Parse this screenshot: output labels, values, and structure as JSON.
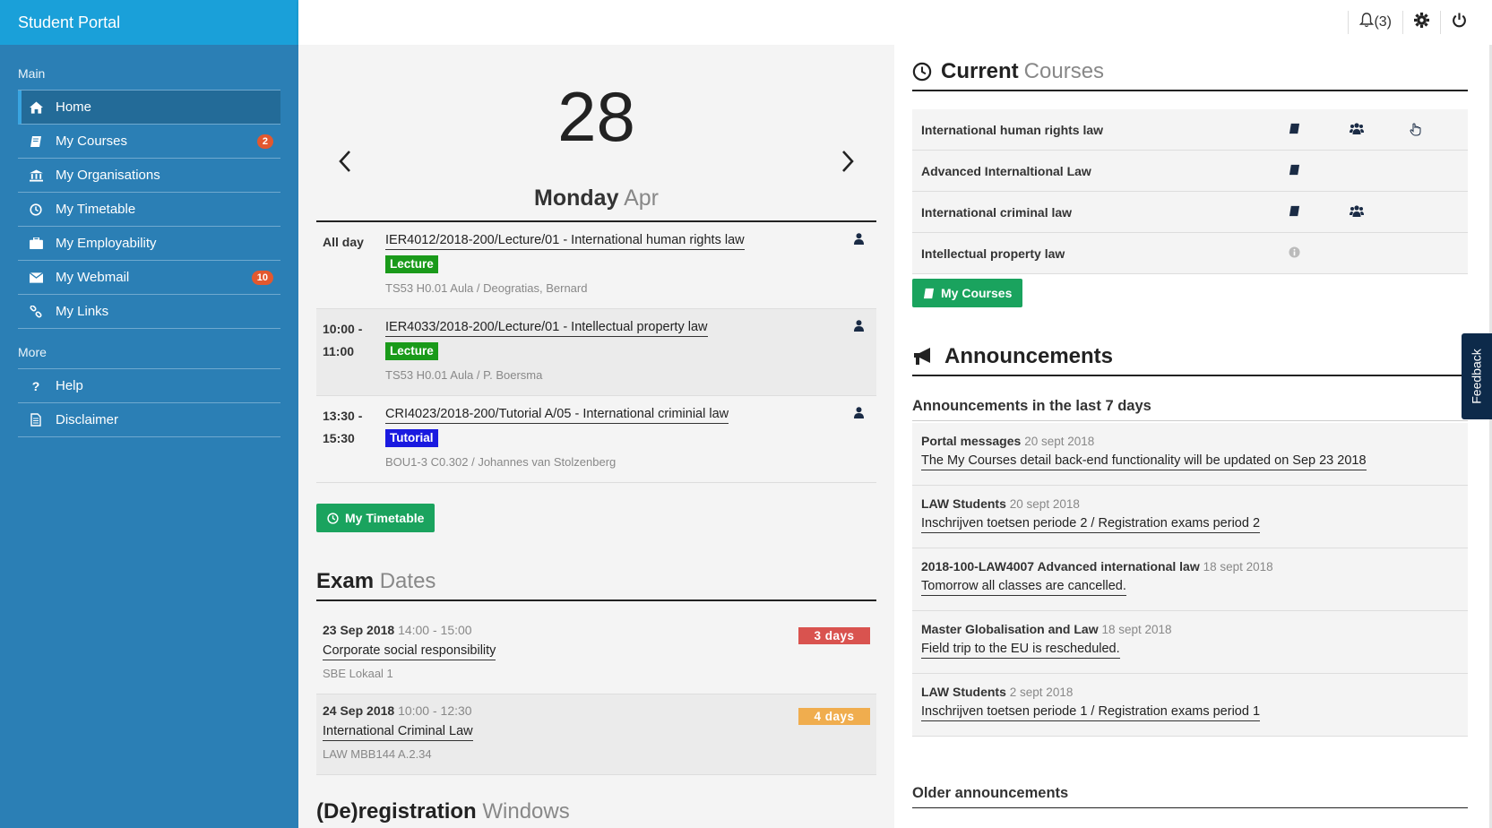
{
  "app": {
    "title": "Student Portal"
  },
  "sidebar": {
    "main_heading": "Main",
    "more_heading": "More",
    "main_items": [
      {
        "label": "Home",
        "icon": "home-icon",
        "active": true,
        "badge": ""
      },
      {
        "label": "My Courses",
        "icon": "book-icon",
        "badge": "2"
      },
      {
        "label": "My Organisations",
        "icon": "institution-icon",
        "badge": ""
      },
      {
        "label": "My Timetable",
        "icon": "clock-icon",
        "badge": ""
      },
      {
        "label": "My Employability",
        "icon": "briefcase-icon",
        "badge": ""
      },
      {
        "label": "My Webmail",
        "icon": "envelope-icon",
        "badge": "10"
      },
      {
        "label": "My Links",
        "icon": "link-icon",
        "badge": ""
      }
    ],
    "more_items": [
      {
        "label": "Help",
        "icon": "question-icon"
      },
      {
        "label": "Disclaimer",
        "icon": "document-icon"
      }
    ]
  },
  "topbar": {
    "notifications": "(3)"
  },
  "date": {
    "day": "28",
    "weekday": "Monday",
    "month": "Apr"
  },
  "schedule": [
    {
      "time": "All day",
      "title": "IER4012/2018-200/Lecture/01 - International human rights law",
      "type": "Lecture",
      "location": "TS53 H0.01 Aula / Deogratias, Bernard"
    },
    {
      "time": "10:00 - 11:00",
      "title": "IER4033/2018-200/Lecture/01 - Intellectual property law",
      "type": "Lecture",
      "location": "TS53 H0.01 Aula / P. Boersma"
    },
    {
      "time": "13:30 - 15:30",
      "title": "CRI4023/2018-200/Tutorial A/05 - International criminial law",
      "type": "Tutorial",
      "location": "BOU1-3 C0.302 / Johannes van Stolzenberg"
    }
  ],
  "timetable_button": "My Timetable",
  "exam_section": {
    "bold": "Exam",
    "light": "Dates"
  },
  "exams": [
    {
      "date": "23 Sep 2018",
      "time": "14:00 - 15:00",
      "name": "Corporate social responsibility",
      "location": "SBE Lokaal 1",
      "countdown": "3 days",
      "color": "#d9534f"
    },
    {
      "date": "24 Sep 2018",
      "time": "10:00 - 12:30",
      "name": "International Criminal Law",
      "location": "LAW MBB144 A.2.34",
      "countdown": "4 days",
      "color": "#f0ad4e"
    }
  ],
  "reg_section": {
    "bold": "(De)registration",
    "light": "Windows"
  },
  "courses_section": {
    "bold": "Current",
    "light": "Courses"
  },
  "courses": [
    {
      "name": "International human rights law",
      "icons": [
        "book-icon",
        "group-icon",
        "hand-pointer-icon"
      ]
    },
    {
      "name": "Advanced Internaltional Law",
      "icons": [
        "book-icon"
      ]
    },
    {
      "name": "International criminal law",
      "icons": [
        "book-icon",
        "group-icon"
      ]
    },
    {
      "name": "Intellectual property law",
      "icons": [
        "info-icon"
      ]
    }
  ],
  "courses_button": "My Courses",
  "ann_section": {
    "title": "Announcements"
  },
  "ann_recent_heading": "Announcements in the last 7 days",
  "announcements": [
    {
      "source": "Portal messages",
      "date": "20 sept 2018",
      "text": "The My Courses detail back-end functionality will be updated on Sep 23 2018"
    },
    {
      "source": "LAW Students",
      "date": "20 sept 2018",
      "text": "Inschrijven toetsen periode 2 / Registration exams period 2"
    },
    {
      "source": "2018-100-LAW4007 Advanced international law",
      "date": "18 sept 2018",
      "text": "Tomorrow all classes are cancelled."
    },
    {
      "source": "Master Globalisation and Law",
      "date": "18 sept 2018",
      "text": "Field trip to the EU is rescheduled."
    },
    {
      "source": "LAW Students",
      "date": "2 sept 2018",
      "text": "Inschrijven toetsen periode 1 / Registration exams period 1"
    }
  ],
  "ann_older_heading": "Older announcements",
  "feedback": "Feedback"
}
